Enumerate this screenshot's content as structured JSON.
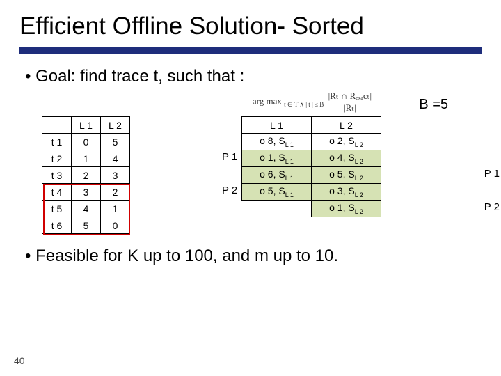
{
  "title": "Efficient Offline Solution- Sorted",
  "goal_text": "Goal: find trace t, such that :",
  "formula": {
    "argmax": "arg max",
    "sub": "t ∈ T ∧ | t | ≤ B",
    "num": "|Rₜ ∩ Rₑₓₐcₜ|",
    "den": "|Rₜ|"
  },
  "b_label": "B =5",
  "left_headers": [
    "",
    "L 1",
    "L 2"
  ],
  "trace_rows": [
    {
      "t": "t 1",
      "l1": "0",
      "l2": "5"
    },
    {
      "t": "t 2",
      "l1": "1",
      "l2": "4"
    },
    {
      "t": "t 3",
      "l1": "2",
      "l2": "3"
    },
    {
      "t": "t 4",
      "l1": "3",
      "l2": "2"
    },
    {
      "t": "t 5",
      "l1": "4",
      "l2": "1"
    },
    {
      "t": "t 6",
      "l1": "5",
      "l2": "0"
    }
  ],
  "right_headers": [
    "L 1",
    "L 2"
  ],
  "right_rows": [
    {
      "a": "o 8",
      "as": "L 1",
      "b": "o 2",
      "bs": "L 2",
      "shade": false
    },
    {
      "a": "o 1",
      "as": "L 1",
      "b": "o 4",
      "bs": "L 2",
      "shade": true
    },
    {
      "a": "o 6",
      "as": "L 1",
      "b": "o 5",
      "bs": "L 2",
      "shade": true
    },
    {
      "a": "o 5",
      "as": "L 1",
      "b": "o 3",
      "bs": "L 2",
      "shade": true
    },
    {
      "a": "",
      "as": "",
      "b": "o 1",
      "bs": "L 2",
      "shade": true
    }
  ],
  "p_labels": {
    "p1": "P 1",
    "p2": "P 2"
  },
  "feasible_text": "Feasible for K up to 100, and m up to 10.",
  "slide_number": "40"
}
